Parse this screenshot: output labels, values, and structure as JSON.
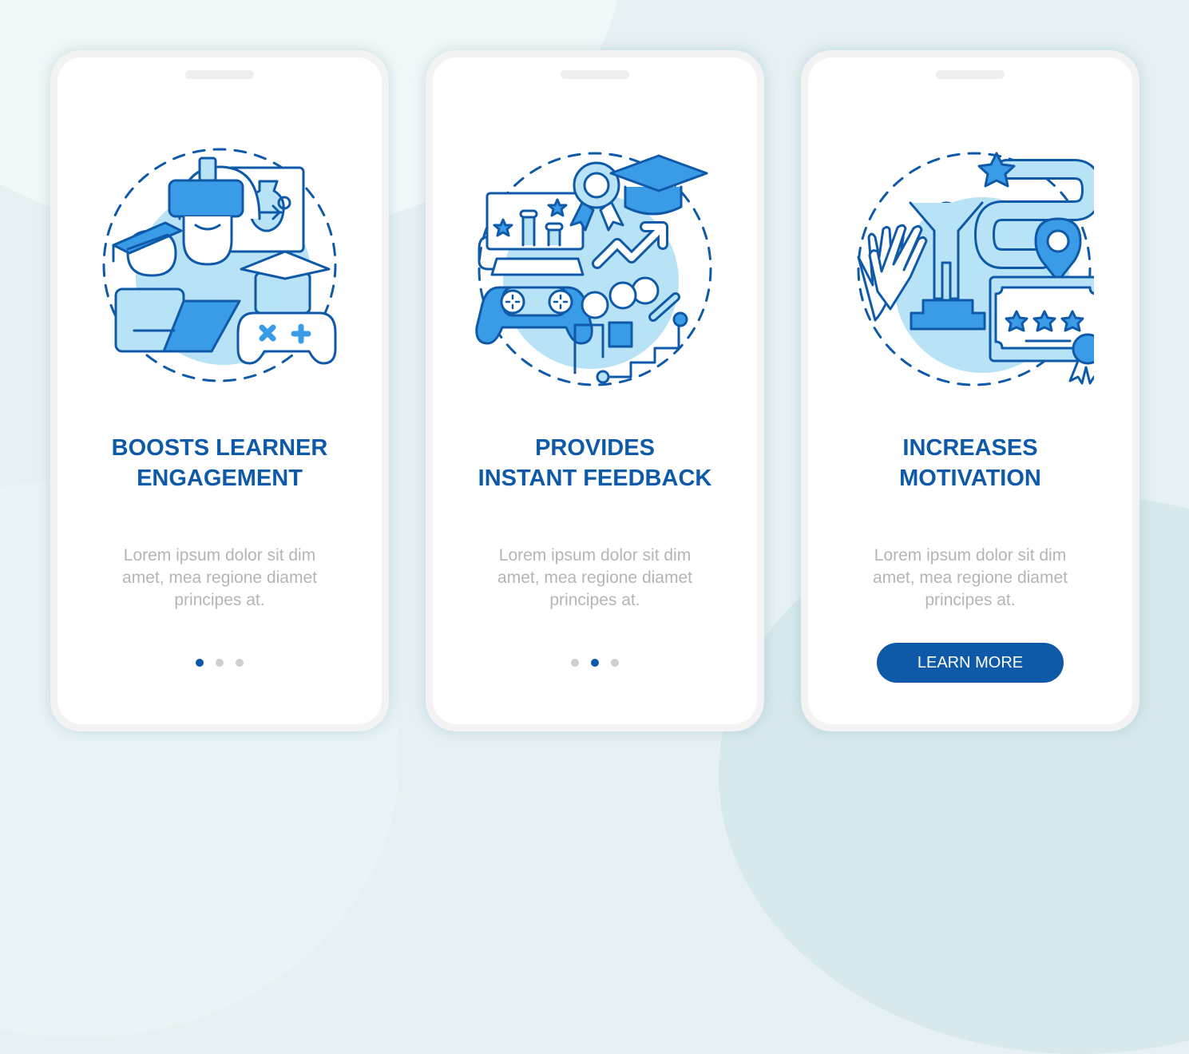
{
  "colors": {
    "primary": "#0f5aa8",
    "accent_light": "#b8e2f5",
    "accent_mid": "#3a9be6",
    "stroke": "#0f5aa8",
    "body_text": "#b5b5b5",
    "dot_inactive": "#cfcfcf"
  },
  "screens": [
    {
      "title_line1": "BOOSTS LEARNER",
      "title_line2": "ENGAGEMENT",
      "body_line1": "Lorem ipsum dolor sit dim",
      "body_line2": "amet, mea regione diamet",
      "body_line3": "principes at.",
      "illustration": "vr-learning-gamepad-graduates-illustration",
      "pagination": {
        "total": 3,
        "active": 1
      }
    },
    {
      "title_line1": "PROVIDES",
      "title_line2": "INSTANT FEEDBACK",
      "body_line1": "Lorem ipsum dolor sit dim",
      "body_line2": "amet, mea regione diamet",
      "body_line3": "principes at.",
      "illustration": "leaderboard-award-progress-illustration",
      "pagination": {
        "total": 3,
        "active": 2
      }
    },
    {
      "title_line1": "INCREASES",
      "title_line2": "MOTIVATION",
      "body_line1": "Lorem ipsum dolor sit dim",
      "body_line2": "amet, mea regione diamet",
      "body_line3": "principes at.",
      "illustration": "winner-podium-certificate-path-illustration",
      "button_label": "LEARN MORE"
    }
  ]
}
